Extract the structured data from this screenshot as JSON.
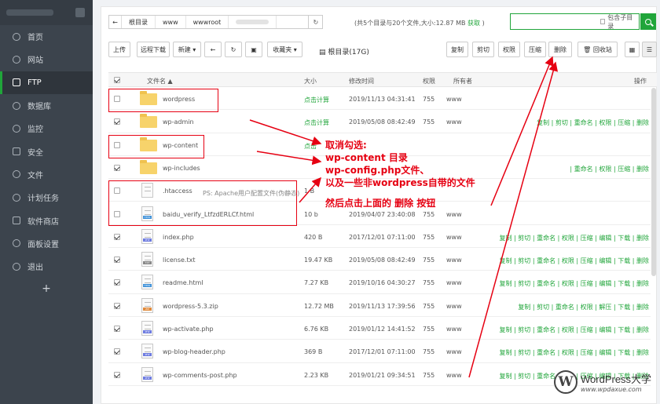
{
  "sidebar": {
    "items": [
      {
        "label": "首页",
        "icon": "home-icon"
      },
      {
        "label": "网站",
        "icon": "globe-icon"
      },
      {
        "label": "FTP",
        "icon": "user-icon",
        "active": true
      },
      {
        "label": "数据库",
        "icon": "database-icon"
      },
      {
        "label": "监控",
        "icon": "monitor-icon"
      },
      {
        "label": "安全",
        "icon": "shield-icon"
      },
      {
        "label": "文件",
        "icon": "folder-icon"
      },
      {
        "label": "计划任务",
        "icon": "calendar-icon"
      },
      {
        "label": "软件商店",
        "icon": "store-icon"
      },
      {
        "label": "面板设置",
        "icon": "gear-icon"
      },
      {
        "label": "退出",
        "icon": "logout-icon"
      }
    ],
    "plus": "+"
  },
  "path": {
    "crumbs": [
      "根目录",
      "www",
      "wwwroot"
    ],
    "info": "(共5个目录与20个文件,大小:12.87 MB",
    "info_link": "获取",
    "info_end": ")"
  },
  "search": {
    "placeholder": "",
    "subdir_label": "包含子目录"
  },
  "toolbar": {
    "upload": "上传",
    "remote_download": "远程下载",
    "new": "新建 ▾",
    "favorites": "收藏夹 ▾",
    "disk": "根目录(17G)",
    "copy": "复制",
    "cut": "剪切",
    "perm": "权限",
    "compress": "压缩",
    "delete": "删除",
    "recycle": "回收站"
  },
  "table": {
    "headers": {
      "name": "文件名 ▲",
      "size": "大小",
      "mtime": "修改时间",
      "perm": "权限",
      "owner": "所有者",
      "ops": "操作"
    },
    "rows": [
      {
        "type": "folder",
        "name": "wordpress",
        "size": "点击计算",
        "mtime": "2019/11/13 04:31:41",
        "perm": "755",
        "owner": "www",
        "checked": false,
        "ops": ""
      },
      {
        "type": "folder",
        "name": "wp-admin",
        "size": "点击计算",
        "mtime": "2019/05/08 08:42:49",
        "perm": "755",
        "owner": "www",
        "checked": true,
        "ops": "复制 | 剪切 | 重命名 | 权限 | 压缩 | 删除"
      },
      {
        "type": "folder",
        "name": "wp-content",
        "size": "点击",
        "mtime": "",
        "perm": "",
        "owner": "",
        "checked": false,
        "ops": ""
      },
      {
        "type": "folder",
        "name": "wp-includes",
        "size": "",
        "mtime": "",
        "perm": "",
        "owner": "",
        "checked": true,
        "ops": "| 重命名 | 权限 | 压缩 | 删除"
      },
      {
        "type": "file",
        "name": ".htaccess",
        "size": "1 B",
        "mtime": "",
        "perm": "",
        "owner": "",
        "checked": false,
        "ops": "",
        "tag": ""
      },
      {
        "type": "file",
        "name": "baidu_verify_LtfzdERLCf.html",
        "size": "10 b",
        "mtime": "2019/04/07 23:40:08",
        "perm": "755",
        "owner": "www",
        "checked": false,
        "ops": "",
        "tag": "HTML"
      },
      {
        "type": "file",
        "name": "index.php",
        "size": "420 B",
        "mtime": "2017/12/01 07:11:00",
        "perm": "755",
        "owner": "www",
        "checked": true,
        "ops": "复制 | 剪切 | 重命名 | 权限 | 压缩 | 编辑 | 下载 | 删除",
        "tag": "PHP"
      },
      {
        "type": "file",
        "name": "license.txt",
        "size": "19.47 KB",
        "mtime": "2019/05/08 08:42:49",
        "perm": "755",
        "owner": "www",
        "checked": true,
        "ops": "复制 | 剪切 | 重命名 | 权限 | 压缩 | 编辑 | 下载 | 删除",
        "tag": "TXT"
      },
      {
        "type": "file",
        "name": "readme.html",
        "size": "7.27 KB",
        "mtime": "2019/10/16 04:30:27",
        "perm": "755",
        "owner": "www",
        "checked": true,
        "ops": "复制 | 剪切 | 重命名 | 权限 | 压缩 | 编辑 | 下载 | 删除",
        "tag": "HTML"
      },
      {
        "type": "file",
        "name": "wordpress-5.3.zip",
        "size": "12.72 MB",
        "mtime": "2019/11/13 17:39:56",
        "perm": "755",
        "owner": "www",
        "checked": true,
        "ops": "复制 | 剪切 | 重命名 | 权限 | 解压 | 下载 | 删除",
        "tag": "ZIP"
      },
      {
        "type": "file",
        "name": "wp-activate.php",
        "size": "6.76 KB",
        "mtime": "2019/01/12 14:41:52",
        "perm": "755",
        "owner": "www",
        "checked": true,
        "ops": "复制 | 剪切 | 重命名 | 权限 | 压缩 | 编辑 | 下载 | 删除",
        "tag": "PHP"
      },
      {
        "type": "file",
        "name": "wp-blog-header.php",
        "size": "369 B",
        "mtime": "2017/12/01 07:11:00",
        "perm": "755",
        "owner": "www",
        "checked": true,
        "ops": "复制 | 剪切 | 重命名 | 权限 | 压缩 | 编辑 | 下载 | 删除",
        "tag": "PHP"
      },
      {
        "type": "file",
        "name": "wp-comments-post.php",
        "size": "2.23 KB",
        "mtime": "2019/01/21 09:34:51",
        "perm": "755",
        "owner": "www",
        "checked": true,
        "ops": "复制 | 剪切 | 重命名 | 权限 | 压缩 | 编辑 | 下载 | 删除",
        "tag": "PHP"
      }
    ]
  },
  "annotation": {
    "line1": "取消勾选:",
    "line2": "wp-content 目录",
    "line3": "wp-config.php文件、",
    "line4": "以及一些非wordpress自带的文件",
    "line5": "然后点击上面的 删除 按钮",
    "ps": "PS: Apache用户配置文件(伪静态)"
  },
  "watermark": {
    "logo": "W",
    "title": "WordPress大学",
    "url": "www.wpdaxue.com"
  },
  "colors": {
    "accent": "#20a53a",
    "annotation": "#e60012",
    "sidebar": "#3c444d"
  }
}
